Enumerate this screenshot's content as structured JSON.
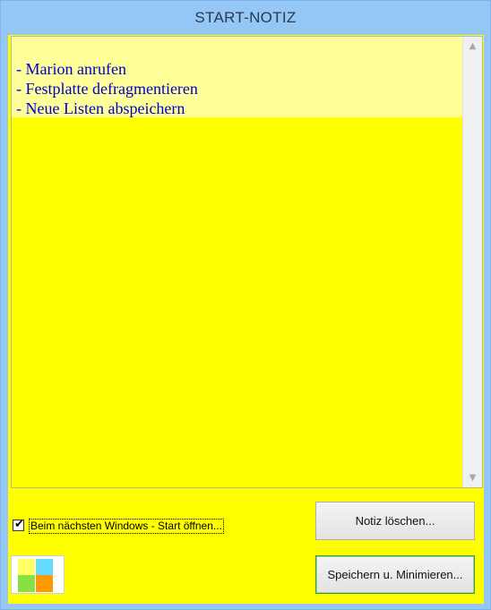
{
  "window": {
    "title": "START-NOTIZ"
  },
  "note": {
    "lines": [
      "- Marion anrufen",
      "- Festplatte defragmentieren",
      "- Neue Listen abspeichern"
    ]
  },
  "scrollbar": {
    "up_arrow": "▲",
    "down_arrow": "▼"
  },
  "options": {
    "open_on_start_label": "Beim nächsten Windows - Start öffnen...",
    "open_on_start_checked": true,
    "check_glyph": "✔"
  },
  "buttons": {
    "clear_label": "Notiz löschen...",
    "save_label": "Speichern u. Minimieren..."
  },
  "logo": {
    "colors": [
      "#ffff66",
      "#66d9ff",
      "#88e044",
      "#ff9900"
    ]
  },
  "colors": {
    "note_background": "#ffff00",
    "text_highlight": "#ffff99",
    "text_color": "#0000c8",
    "title_bar": "#94c7f5"
  }
}
